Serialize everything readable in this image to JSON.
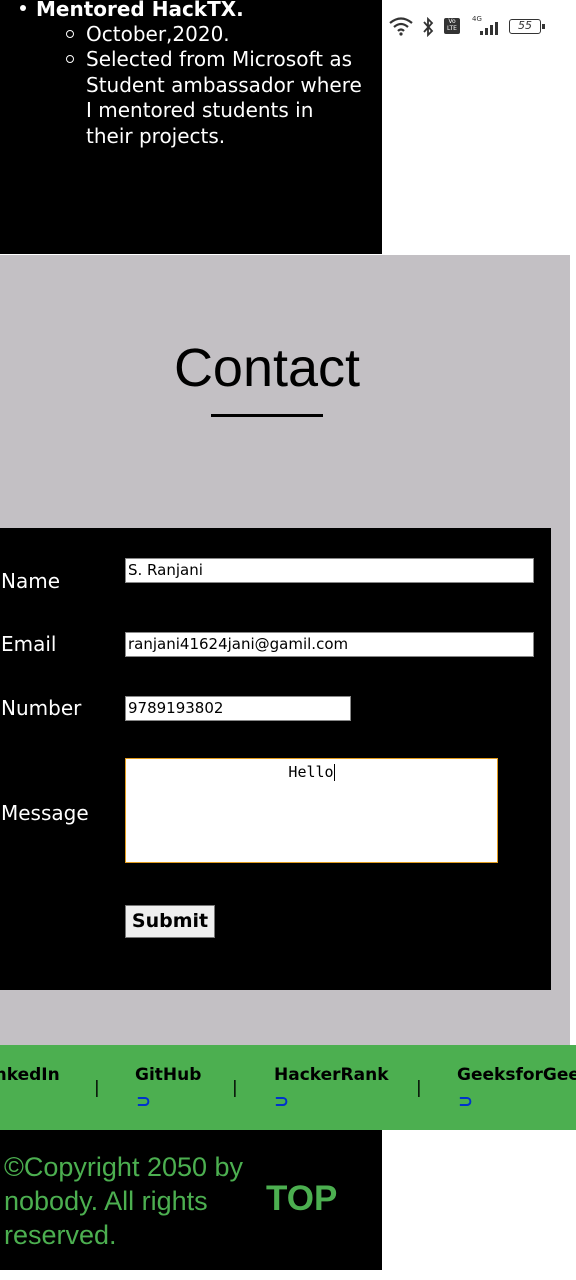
{
  "experience": {
    "title": "Mentored HackTX.",
    "items": [
      "October,2020.",
      "Selected from Microsoft as Student ambassador where I mentored students in their projects."
    ]
  },
  "status_bar": {
    "network": "4G",
    "volte": "Vo LTE",
    "battery": "55"
  },
  "contact": {
    "title": "Contact",
    "form": {
      "name_label": "Name",
      "name_value": "S. Ranjani",
      "email_label": "Email",
      "email_value": "ranjani41624jani@gamil.com",
      "number_label": "Number",
      "number_value": "9789193802",
      "message_label": "Message",
      "message_value": "Hello",
      "submit_label": "Submit"
    }
  },
  "links": {
    "items": [
      "LinkedIn",
      "GitHub",
      "HackerRank",
      "GeeksforGeeks"
    ],
    "separator": "|",
    "icon": "link-icon"
  },
  "footer": {
    "copyright": "©Copyright 2050 by nobody. All rights reserved.",
    "top_label": "TOP"
  },
  "colors": {
    "accent_green": "#4caf50",
    "contact_bg": "#c3c0c4",
    "dark_bg": "#000000",
    "focus_border": "#e29c1e",
    "link_icon": "#0033cc"
  }
}
